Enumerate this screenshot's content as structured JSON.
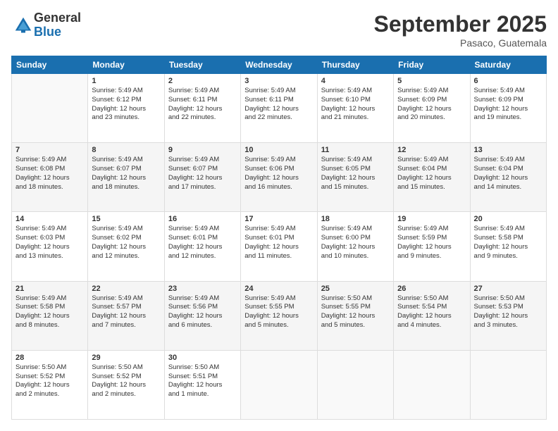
{
  "logo": {
    "general": "General",
    "blue": "Blue"
  },
  "header": {
    "month": "September 2025",
    "location": "Pasaco, Guatemala"
  },
  "columns": [
    "Sunday",
    "Monday",
    "Tuesday",
    "Wednesday",
    "Thursday",
    "Friday",
    "Saturday"
  ],
  "weeks": [
    [
      {
        "day": "",
        "text": ""
      },
      {
        "day": "1",
        "text": "Sunrise: 5:49 AM\nSunset: 6:12 PM\nDaylight: 12 hours\nand 23 minutes."
      },
      {
        "day": "2",
        "text": "Sunrise: 5:49 AM\nSunset: 6:11 PM\nDaylight: 12 hours\nand 22 minutes."
      },
      {
        "day": "3",
        "text": "Sunrise: 5:49 AM\nSunset: 6:11 PM\nDaylight: 12 hours\nand 22 minutes."
      },
      {
        "day": "4",
        "text": "Sunrise: 5:49 AM\nSunset: 6:10 PM\nDaylight: 12 hours\nand 21 minutes."
      },
      {
        "day": "5",
        "text": "Sunrise: 5:49 AM\nSunset: 6:09 PM\nDaylight: 12 hours\nand 20 minutes."
      },
      {
        "day": "6",
        "text": "Sunrise: 5:49 AM\nSunset: 6:09 PM\nDaylight: 12 hours\nand 19 minutes."
      }
    ],
    [
      {
        "day": "7",
        "text": "Sunrise: 5:49 AM\nSunset: 6:08 PM\nDaylight: 12 hours\nand 18 minutes."
      },
      {
        "day": "8",
        "text": "Sunrise: 5:49 AM\nSunset: 6:07 PM\nDaylight: 12 hours\nand 18 minutes."
      },
      {
        "day": "9",
        "text": "Sunrise: 5:49 AM\nSunset: 6:07 PM\nDaylight: 12 hours\nand 17 minutes."
      },
      {
        "day": "10",
        "text": "Sunrise: 5:49 AM\nSunset: 6:06 PM\nDaylight: 12 hours\nand 16 minutes."
      },
      {
        "day": "11",
        "text": "Sunrise: 5:49 AM\nSunset: 6:05 PM\nDaylight: 12 hours\nand 15 minutes."
      },
      {
        "day": "12",
        "text": "Sunrise: 5:49 AM\nSunset: 6:04 PM\nDaylight: 12 hours\nand 15 minutes."
      },
      {
        "day": "13",
        "text": "Sunrise: 5:49 AM\nSunset: 6:04 PM\nDaylight: 12 hours\nand 14 minutes."
      }
    ],
    [
      {
        "day": "14",
        "text": "Sunrise: 5:49 AM\nSunset: 6:03 PM\nDaylight: 12 hours\nand 13 minutes."
      },
      {
        "day": "15",
        "text": "Sunrise: 5:49 AM\nSunset: 6:02 PM\nDaylight: 12 hours\nand 12 minutes."
      },
      {
        "day": "16",
        "text": "Sunrise: 5:49 AM\nSunset: 6:01 PM\nDaylight: 12 hours\nand 12 minutes."
      },
      {
        "day": "17",
        "text": "Sunrise: 5:49 AM\nSunset: 6:01 PM\nDaylight: 12 hours\nand 11 minutes."
      },
      {
        "day": "18",
        "text": "Sunrise: 5:49 AM\nSunset: 6:00 PM\nDaylight: 12 hours\nand 10 minutes."
      },
      {
        "day": "19",
        "text": "Sunrise: 5:49 AM\nSunset: 5:59 PM\nDaylight: 12 hours\nand 9 minutes."
      },
      {
        "day": "20",
        "text": "Sunrise: 5:49 AM\nSunset: 5:58 PM\nDaylight: 12 hours\nand 9 minutes."
      }
    ],
    [
      {
        "day": "21",
        "text": "Sunrise: 5:49 AM\nSunset: 5:58 PM\nDaylight: 12 hours\nand 8 minutes."
      },
      {
        "day": "22",
        "text": "Sunrise: 5:49 AM\nSunset: 5:57 PM\nDaylight: 12 hours\nand 7 minutes."
      },
      {
        "day": "23",
        "text": "Sunrise: 5:49 AM\nSunset: 5:56 PM\nDaylight: 12 hours\nand 6 minutes."
      },
      {
        "day": "24",
        "text": "Sunrise: 5:49 AM\nSunset: 5:55 PM\nDaylight: 12 hours\nand 5 minutes."
      },
      {
        "day": "25",
        "text": "Sunrise: 5:50 AM\nSunset: 5:55 PM\nDaylight: 12 hours\nand 5 minutes."
      },
      {
        "day": "26",
        "text": "Sunrise: 5:50 AM\nSunset: 5:54 PM\nDaylight: 12 hours\nand 4 minutes."
      },
      {
        "day": "27",
        "text": "Sunrise: 5:50 AM\nSunset: 5:53 PM\nDaylight: 12 hours\nand 3 minutes."
      }
    ],
    [
      {
        "day": "28",
        "text": "Sunrise: 5:50 AM\nSunset: 5:52 PM\nDaylight: 12 hours\nand 2 minutes."
      },
      {
        "day": "29",
        "text": "Sunrise: 5:50 AM\nSunset: 5:52 PM\nDaylight: 12 hours\nand 2 minutes."
      },
      {
        "day": "30",
        "text": "Sunrise: 5:50 AM\nSunset: 5:51 PM\nDaylight: 12 hours\nand 1 minute."
      },
      {
        "day": "",
        "text": ""
      },
      {
        "day": "",
        "text": ""
      },
      {
        "day": "",
        "text": ""
      },
      {
        "day": "",
        "text": ""
      }
    ]
  ]
}
